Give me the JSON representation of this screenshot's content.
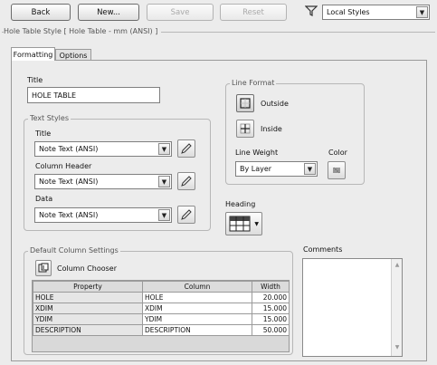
{
  "toolbar": {
    "back_label": "Back",
    "new_label": "New...",
    "save_label": "Save",
    "reset_label": "Reset",
    "filter_value": "Local Styles"
  },
  "dialog": {
    "title": "Hole Table Style [ Hole Table - mm (ANSI) ]"
  },
  "tabs": [
    {
      "label": "Formatting",
      "active": true
    },
    {
      "label": "Options",
      "active": false
    }
  ],
  "title_section": {
    "label": "Title",
    "value": "HOLE TABLE"
  },
  "text_styles": {
    "legend": "Text Styles",
    "title_label": "Title",
    "title_value": "Note Text (ANSI)",
    "column_header_label": "Column Header",
    "column_header_value": "Note Text (ANSI)",
    "data_label": "Data",
    "data_value": "Note Text (ANSI)"
  },
  "line_format": {
    "legend": "Line Format",
    "outside_label": "Outside",
    "inside_label": "Inside",
    "line_weight_label": "Line Weight",
    "line_weight_value": "By Layer",
    "color_label": "Color"
  },
  "heading": {
    "label": "Heading"
  },
  "column_settings": {
    "legend": "Default Column Settings",
    "chooser_label": "Column Chooser",
    "headers": [
      "Property",
      "Column",
      "Width"
    ],
    "rows": [
      {
        "property": "HOLE",
        "column": "HOLE",
        "width": "20.000"
      },
      {
        "property": "XDIM",
        "column": "XDIM",
        "width": "15.000"
      },
      {
        "property": "YDIM",
        "column": "YDIM",
        "width": "15.000"
      },
      {
        "property": "DESCRIPTION",
        "column": "DESCRIPTION",
        "width": "50.000"
      }
    ]
  },
  "comments": {
    "label": "Comments",
    "value": ""
  }
}
